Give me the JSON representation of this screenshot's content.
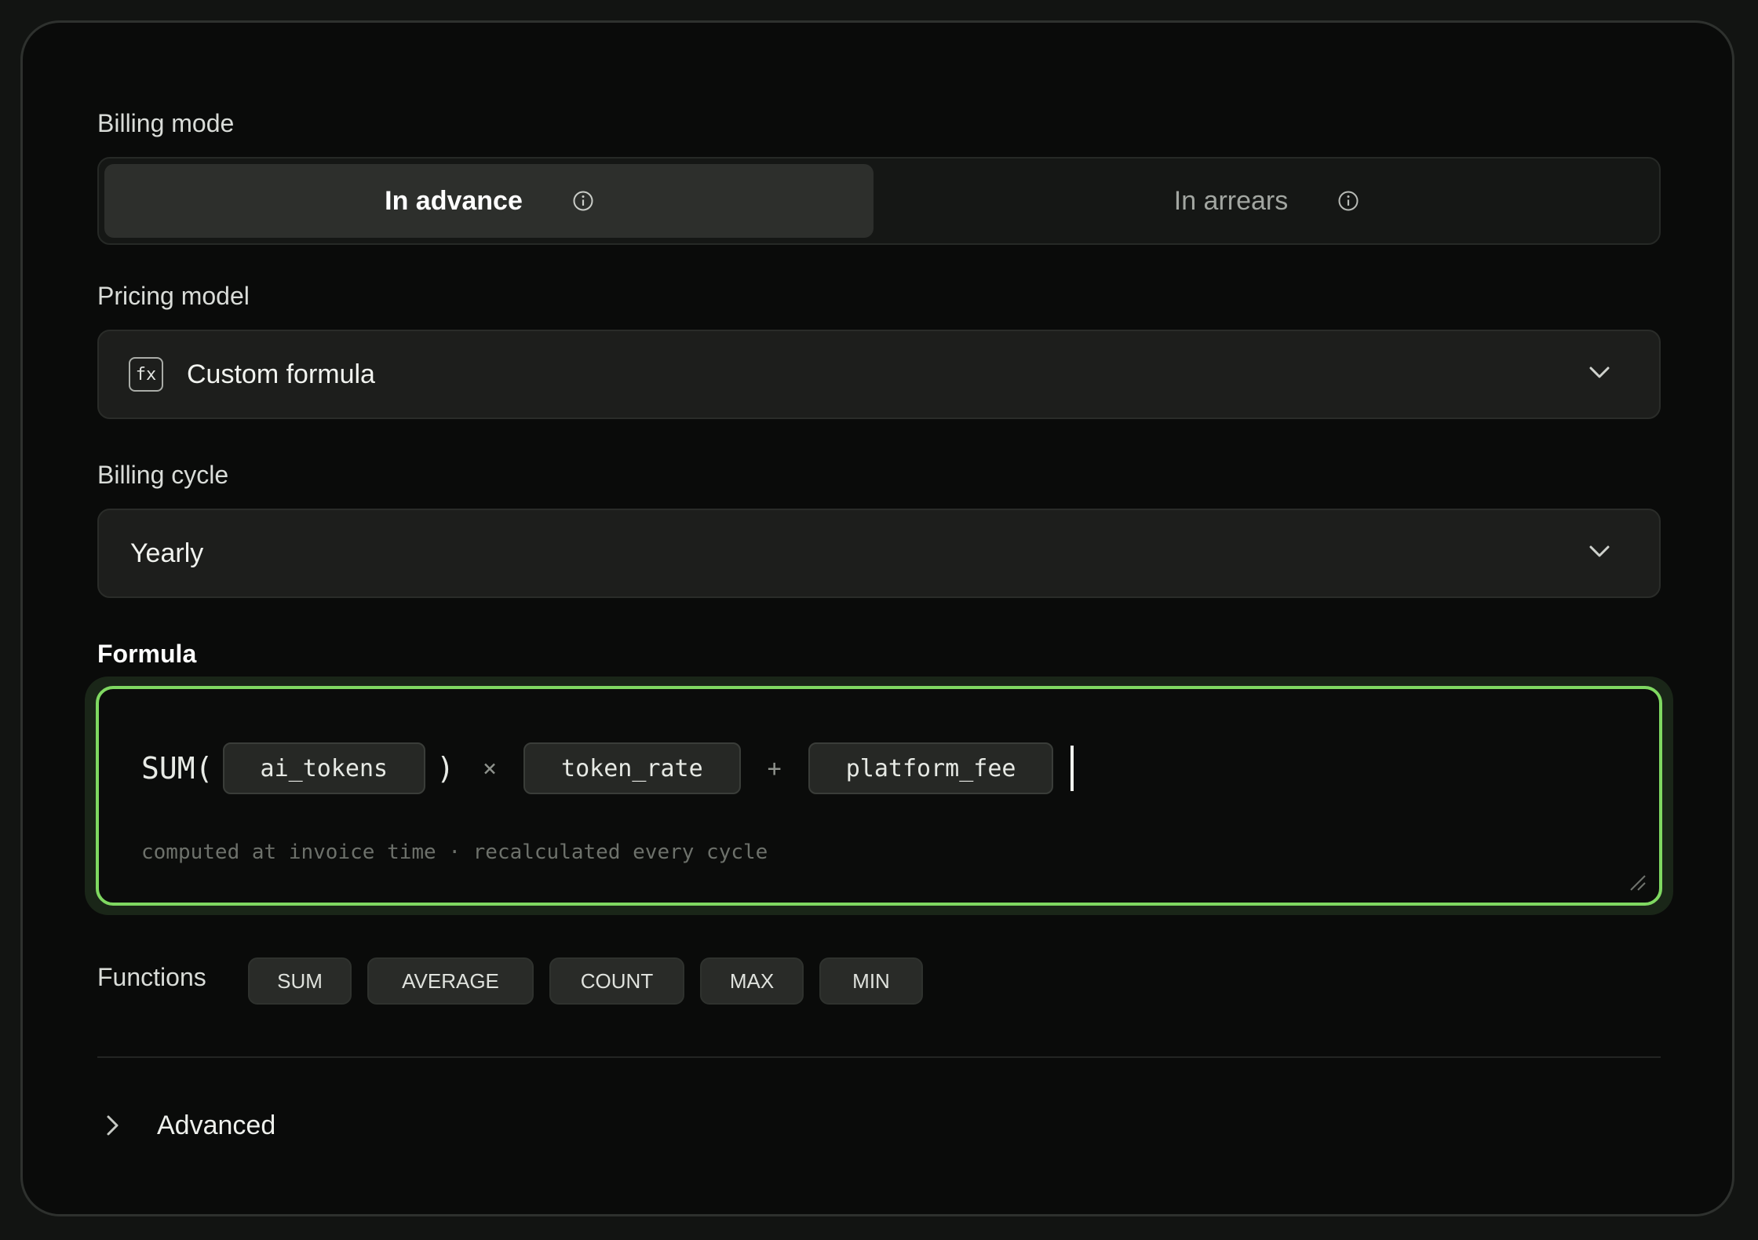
{
  "billing_mode": {
    "label": "Billing mode",
    "options": [
      {
        "label": "In advance",
        "selected": true,
        "icon": "info-icon"
      },
      {
        "label": "In arrears",
        "selected": false,
        "icon": "info-icon"
      }
    ]
  },
  "pricing_model": {
    "label": "Pricing model",
    "icon_text": "fx",
    "value": "Custom formula",
    "icon": "chevron-down-icon"
  },
  "billing_cycle": {
    "label": "Billing cycle",
    "value": "Yearly",
    "icon": "chevron-down-icon"
  },
  "formula": {
    "label": "Formula",
    "function_name": "SUM(",
    "close_paren": ")",
    "tokens": [
      "ai_tokens",
      "token_rate",
      "platform_fee"
    ],
    "operators": [
      "×",
      "+"
    ],
    "hint": "computed at invoice time · recalculated every cycle",
    "accent_color": "#7fd861"
  },
  "functions": {
    "label": "Functions",
    "buttons": [
      "SUM",
      "AVERAGE",
      "COUNT",
      "MAX",
      "MIN"
    ]
  },
  "advanced": {
    "label": "Advanced",
    "icon": "chevron-right-icon"
  }
}
